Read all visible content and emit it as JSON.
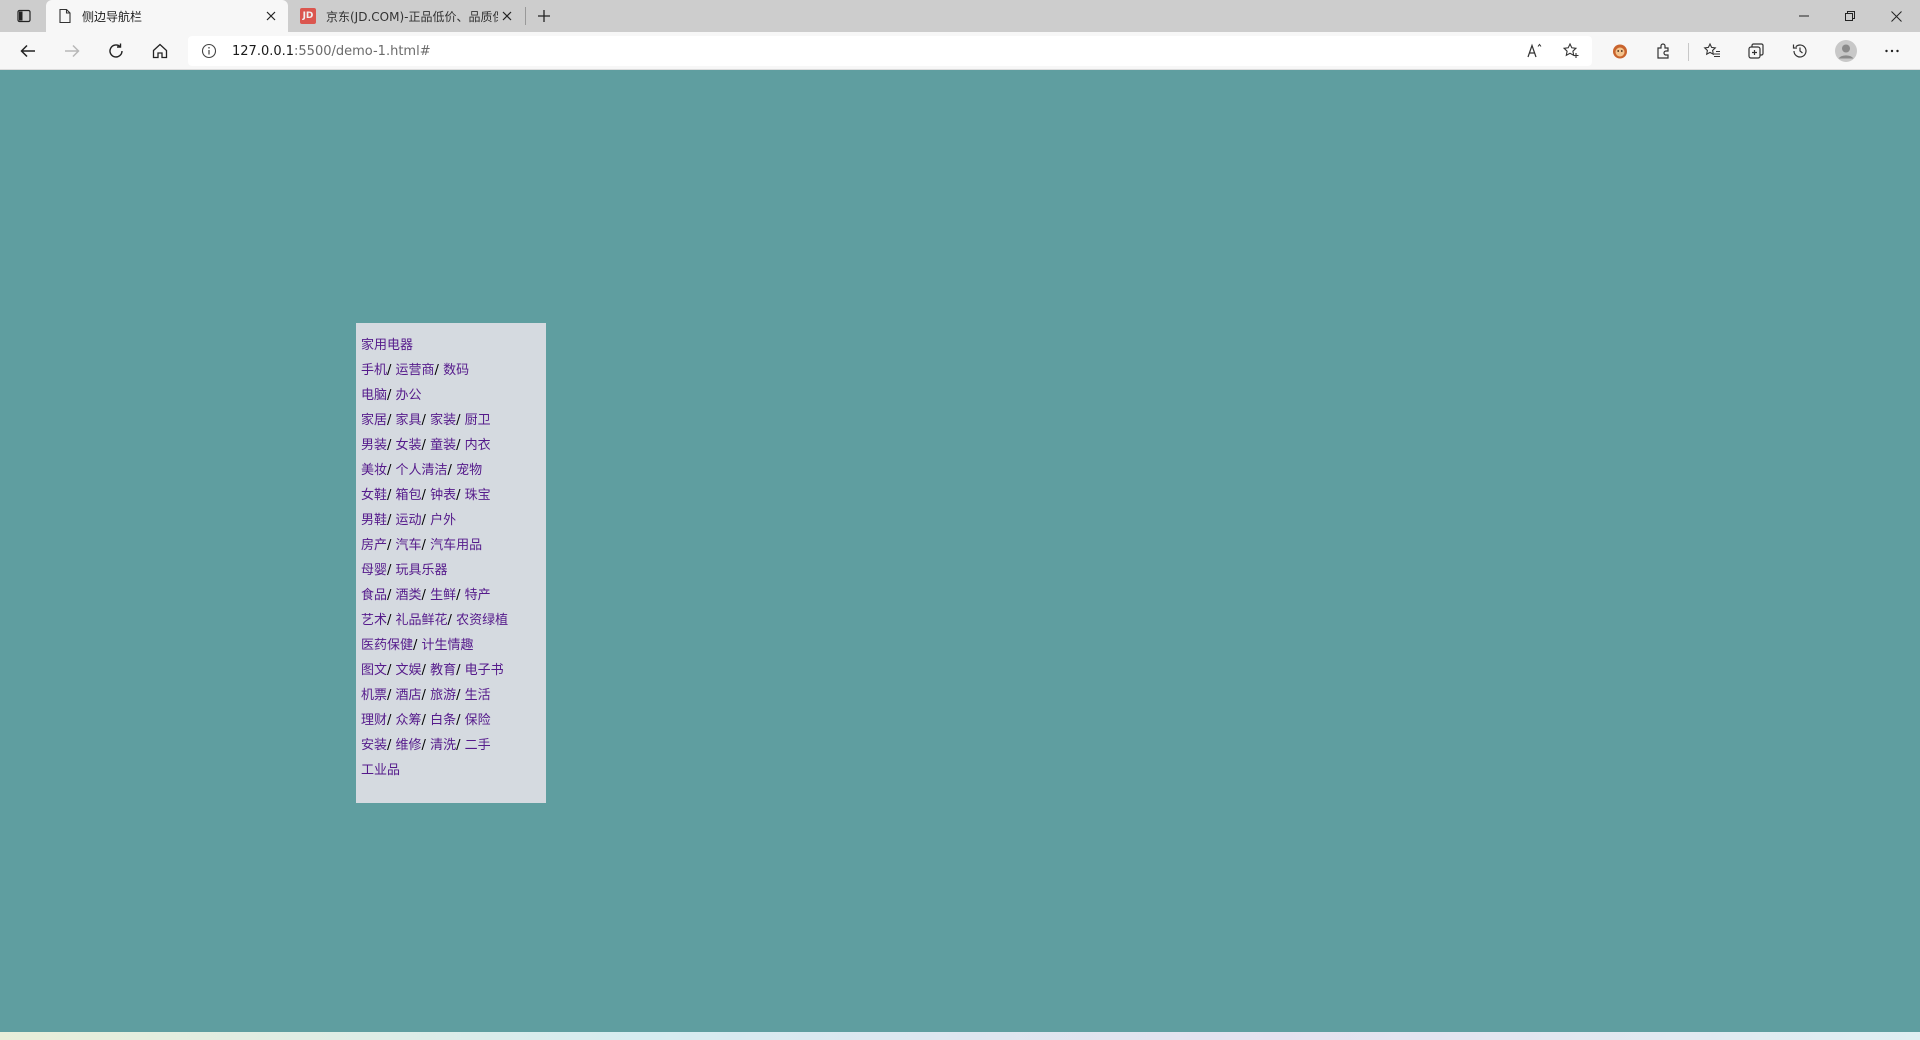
{
  "browser": {
    "tabs": [
      {
        "title": "侧边导航栏",
        "favicon": "page-icon",
        "active": true
      },
      {
        "title": "京东(JD.COM)-正品低价、品质保障",
        "favicon": "jd-favicon",
        "favicon_text": "JD",
        "active": false
      }
    ],
    "address_bar": {
      "host": "127.0.0.1",
      "path": ":5500/demo-1.html#"
    },
    "toolbar_icons": [
      "back-icon",
      "forward-icon",
      "refresh-icon",
      "home-icon",
      "read-aloud-icon",
      "add-favorite-icon",
      "extension-icon",
      "extensions-icon",
      "favorites-icon",
      "collections-icon",
      "history-icon",
      "profile-icon",
      "more-icon"
    ]
  },
  "colors": {
    "page_background": "#5f9ea0",
    "sidenav_background": "#d5dae0",
    "link_color": "#551a8b"
  },
  "sidenav": {
    "separator": "/ ",
    "items": [
      [
        "家用电器"
      ],
      [
        "手机",
        "运营商",
        "数码"
      ],
      [
        "电脑",
        "办公"
      ],
      [
        "家居",
        "家具",
        "家装",
        "厨卫"
      ],
      [
        "男装",
        "女装",
        "童装",
        "内衣"
      ],
      [
        "美妆",
        "个人清洁",
        "宠物"
      ],
      [
        "女鞋",
        "箱包",
        "钟表",
        "珠宝"
      ],
      [
        "男鞋",
        "运动",
        "户外"
      ],
      [
        "房产",
        "汽车",
        "汽车用品"
      ],
      [
        "母婴",
        "玩具乐器"
      ],
      [
        "食品",
        "酒类",
        "生鲜",
        "特产"
      ],
      [
        "艺术",
        "礼品鲜花",
        "农资绿植"
      ],
      [
        "医药保健",
        "计生情趣"
      ],
      [
        "图文",
        "文娱",
        "教育",
        "电子书"
      ],
      [
        "机票",
        "酒店",
        "旅游",
        "生活"
      ],
      [
        "理财",
        "众筹",
        "白条",
        "保险"
      ],
      [
        "安装",
        "维修",
        "清洗",
        "二手"
      ],
      [
        "工业品"
      ]
    ]
  }
}
